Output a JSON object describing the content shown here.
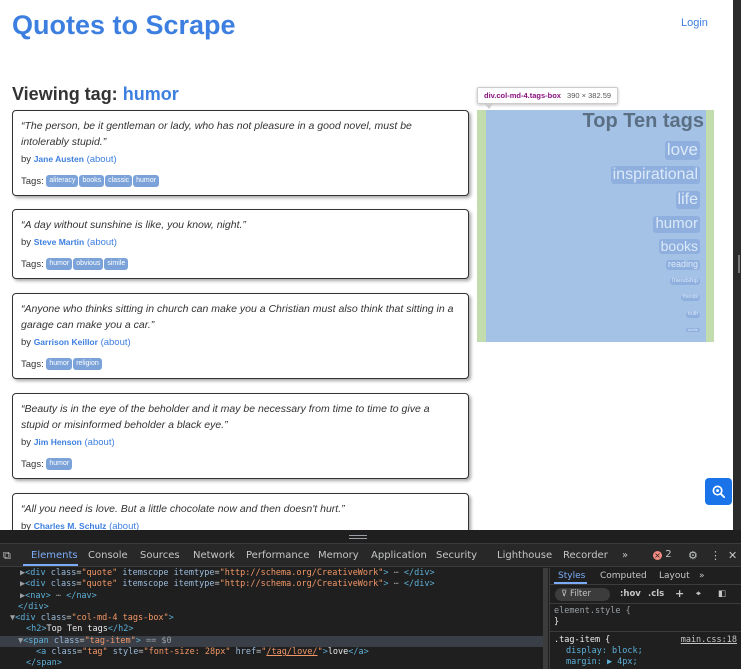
{
  "site": {
    "title": "Quotes to Scrape",
    "login": "Login"
  },
  "heading": {
    "prefix": "Viewing tag:",
    "tag": "humor"
  },
  "quotes": [
    {
      "text": "“The person, be it gentleman or lady, who has not pleasure in a good novel, must be intolerably stupid.”",
      "by": "by",
      "author": "Jane Austen",
      "about": "(about)",
      "tags_label": "Tags:",
      "tags": [
        "aliteracy",
        "books",
        "classic",
        "humor"
      ]
    },
    {
      "text": "“A day without sunshine is like, you know, night.”",
      "by": "by",
      "author": "Steve Martin",
      "about": "(about)",
      "tags_label": "Tags:",
      "tags": [
        "humor",
        "obvious",
        "simile"
      ]
    },
    {
      "text": "“Anyone who thinks sitting in church can make you a Christian must also think that sitting in a garage can make you a car.”",
      "by": "by",
      "author": "Garrison Keillor",
      "about": "(about)",
      "tags_label": "Tags:",
      "tags": [
        "humor",
        "religion"
      ]
    },
    {
      "text": "“Beauty is in the eye of the beholder and it may be necessary from time to time to give a stupid or misinformed beholder a black eye.”",
      "by": "by",
      "author": "Jim Henson",
      "about": "(about)",
      "tags_label": "Tags:",
      "tags": [
        "humor"
      ]
    },
    {
      "text": "“All you need is love. But a little chocolate now and then doesn't hurt.”",
      "by": "by",
      "author": "Charles M. Schulz",
      "about": "(about)",
      "tags_label": "",
      "tags": []
    }
  ],
  "inspector_tooltip": {
    "selector": "div.col-md-4.tags-box",
    "size": "390 × 382.59"
  },
  "top_tags": {
    "title": "Top Ten tags",
    "tags": [
      {
        "label": "love",
        "size": 28
      },
      {
        "label": "inspirational",
        "size": 26
      },
      {
        "label": "life",
        "size": 26
      },
      {
        "label": "humor",
        "size": 24
      },
      {
        "label": "books",
        "size": 22
      },
      {
        "label": "reading",
        "size": 14
      },
      {
        "label": "friendship",
        "size": 10
      },
      {
        "label": "friends",
        "size": 8
      },
      {
        "label": "truth",
        "size": 8
      },
      {
        "label": "simile",
        "size": 6
      }
    ]
  },
  "devtools": {
    "tabs": [
      "Elements",
      "Console",
      "Sources",
      "Network",
      "Performance",
      "Memory",
      "Application",
      "Security",
      "Lighthouse",
      "Recorder"
    ],
    "active_tab": "Elements",
    "more": "»",
    "error_count": "2",
    "dom_lines": [
      {
        "html": "<span class=\"dm\">▶</span><span class=\"tg\">&lt;div </span><span class=\"at\">class</span>=<span class=\"av\">\"quote\"</span> <span class=\"at\">itemscope itemtype</span>=<span class=\"av\">\"http://schema.org/CreativeWork\"</span><span class=\"tg\">&gt;</span><span class=\"dm\"> ⋯ </span><span class=\"tg\">&lt;/div&gt;</span>",
        "indent": 20
      },
      {
        "html": "<span class=\"dm\">▶</span><span class=\"tg\">&lt;div </span><span class=\"at\">class</span>=<span class=\"av\">\"quote\"</span> <span class=\"at\">itemscope itemtype</span>=<span class=\"av\">\"http://schema.org/CreativeWork\"</span><span class=\"tg\">&gt;</span><span class=\"dm\"> ⋯ </span><span class=\"tg\">&lt;/div&gt;</span>",
        "indent": 20
      },
      {
        "html": "<span class=\"dm\">▶</span><span class=\"tg\">&lt;nav&gt;</span><span class=\"dm\"> ⋯ </span><span class=\"tg\">&lt;/nav&gt;</span>",
        "indent": 20
      },
      {
        "html": "<span class=\"tg\">&lt;/div&gt;</span>",
        "indent": 18
      },
      {
        "html": "<span class=\"dm\">▼</span><span class=\"tg\">&lt;div </span><span class=\"at\">class</span>=<span class=\"av\">\"col-md-4 tags-box\"</span><span class=\"tg\">&gt;</span>",
        "indent": 10
      },
      {
        "html": "<span class=\"tg\">&lt;h2&gt;</span><span class=\"tx\">Top Ten tags</span><span class=\"tg\">&lt;/h2&gt;</span>",
        "indent": 26
      },
      {
        "html": "<span class=\"dm\">▼</span><span class=\"tg\">&lt;span </span><span class=\"at\">class</span>=<span class=\"av\">\"tag-item\"</span><span class=\"tg\">&gt;</span><span class=\"dm\"> == $0</span>",
        "indent": 18,
        "selected": true
      },
      {
        "html": "<span class=\"tg\">&lt;a </span><span class=\"at\">class</span>=<span class=\"av\">\"tag\"</span> <span class=\"at\">style</span>=<span class=\"av\">\"font-size: 28px\"</span> <span class=\"at\">href</span>=<span class=\"av\">\"</span><span class=\"lk\">/tag/love/</span><span class=\"av\">\"</span><span class=\"tg\">&gt;</span><span class=\"tx\">love</span><span class=\"tg\">&lt;/a&gt;</span>",
        "indent": 36
      },
      {
        "html": "<span class=\"tg\">&lt;/span&gt;</span>",
        "indent": 26
      }
    ],
    "styles_tabs": [
      "Styles",
      "Computed",
      "Layout",
      "»"
    ],
    "filter_placeholder": "Filter",
    "hov": ":hov",
    "cls": ".cls",
    "element_style": "element.style {",
    "element_style_close": "}",
    "rule_selector": ".tag-item {",
    "rule_source": "main.css:18",
    "rule_props": [
      "display: block;",
      "margin: ▶ 4px;"
    ]
  }
}
